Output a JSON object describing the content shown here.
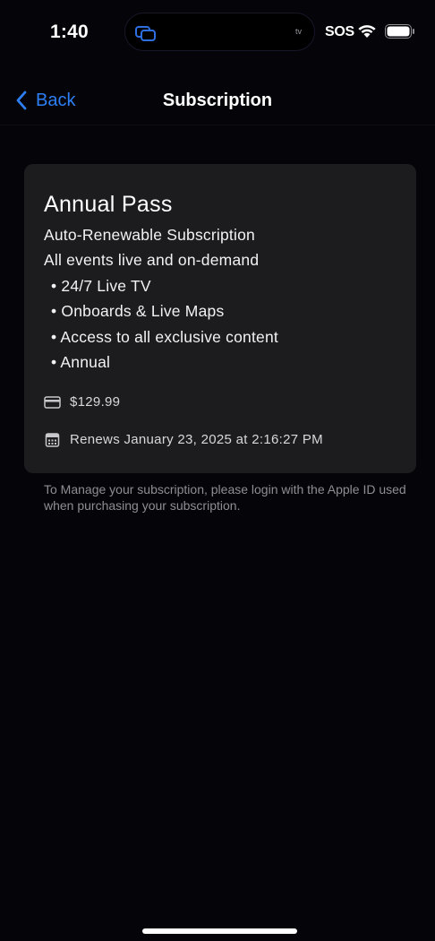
{
  "status_bar": {
    "time": "1:40",
    "island_label": "tv",
    "carrier": "SOS"
  },
  "nav": {
    "back_label": "Back",
    "title": "Subscription"
  },
  "subscription": {
    "plan_name": "Annual Pass",
    "type": "Auto-Renewable Subscription",
    "summary": "All events live and on-demand",
    "features": [
      "• 24/7 Live TV",
      "• Onboards & Live Maps",
      "• Access to all exclusive content",
      "• Annual"
    ],
    "price": "$129.99",
    "renewal": "Renews January 23, 2025 at 2:16:27 PM"
  },
  "footnote": "To Manage your subscription, please login with the Apple ID used when purchasing your subscription.",
  "colors": {
    "accent": "#2d7ff5",
    "card_bg": "#1c1c1f",
    "page_bg": "#050409"
  }
}
